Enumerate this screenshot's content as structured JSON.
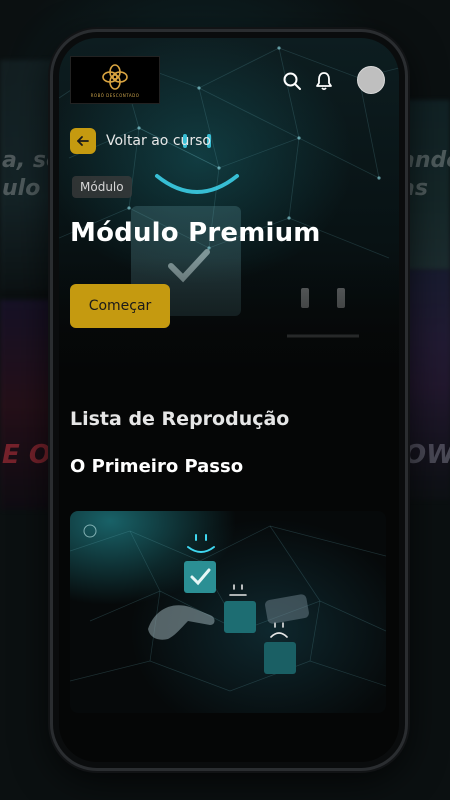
{
  "header": {
    "logo_name": "logo-mark",
    "logo_caption": "ROBÔ DESCONTADO"
  },
  "nav": {
    "back_label": "Voltar ao curso"
  },
  "module": {
    "tag": "Módulo",
    "title": "Módulo Premium",
    "start_button": "Começar"
  },
  "playlist": {
    "heading": "Lista de Reprodução",
    "items": [
      {
        "title": "O Primeiro Passo",
        "thumbnail_icon": "hand-touching-checkbox"
      }
    ]
  },
  "colors": {
    "accent": "#c59a10",
    "background": "#050606",
    "text": "#ffffff"
  },
  "background_posters": {
    "left_text_1": "a, sou",
    "left_text_2": "ulo co",
    "right_text_1": "ando",
    "right_text_2": "as",
    "left_text_3": "E OF",
    "right_text_3": "OW"
  }
}
